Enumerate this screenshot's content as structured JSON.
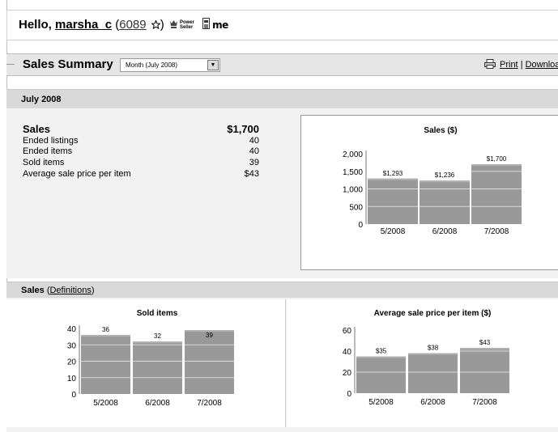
{
  "greeting": {
    "hello": "Hello,",
    "username": "marsha_c",
    "score_open": "(",
    "score": "6089",
    "score_close": ")",
    "power_seller_line1": "Power",
    "power_seller_line2": "Seller",
    "me_badge": "me",
    "star_icon": "star-icon",
    "power_seller_icon": "power-seller-icon",
    "store_icon": "store-icon"
  },
  "summary": {
    "title": "Sales Summary",
    "period_selected": "Month (July 2008)",
    "print_label": "Print",
    "separator": "|",
    "download_label": "Download"
  },
  "month": {
    "title": "July 2008",
    "sales_label": "Sales",
    "sales_value": "$1,700",
    "rows": [
      {
        "label": "Ended listings",
        "value": "40"
      },
      {
        "label": "Ended items",
        "value": "40"
      },
      {
        "label": "Sold items",
        "value": "39"
      },
      {
        "label": "Average sale price per item",
        "value": "$43"
      }
    ]
  },
  "sales_section": {
    "title": "Sales",
    "definitions_label": "Definitions",
    "open": "(",
    "close": ")"
  },
  "colors": {
    "bar": "#999999",
    "bar_line": "#d8d8d8",
    "bar_top": "#b0b0b0"
  },
  "chart_data": [
    {
      "id": "sales-chart",
      "type": "bar",
      "title": "Sales ($)",
      "categories": [
        "5/2008",
        "6/2008",
        "7/2008"
      ],
      "values": [
        1293,
        1236,
        1700
      ],
      "data_labels": [
        "$1,293",
        "$1,236",
        "$1,700"
      ],
      "y_ticks": [
        0,
        500,
        1000,
        1500,
        2000
      ],
      "y_tick_labels": [
        "0",
        "500",
        "1,000",
        "1,500",
        "2,000"
      ],
      "ylim": [
        0,
        2000
      ]
    },
    {
      "id": "sold-chart",
      "type": "bar",
      "title": "Sold items",
      "categories": [
        "5/2008",
        "6/2008",
        "7/2008"
      ],
      "values": [
        36,
        32,
        39
      ],
      "data_labels": [
        "36",
        "32",
        "39"
      ],
      "y_ticks": [
        0,
        10,
        20,
        30,
        40
      ],
      "y_tick_labels": [
        "0",
        "10",
        "20",
        "30",
        "40"
      ],
      "ylim": [
        0,
        40
      ]
    },
    {
      "id": "avg-chart",
      "type": "bar",
      "title": "Average sale price per item ($)",
      "categories": [
        "5/2008",
        "6/2008",
        "7/2008"
      ],
      "values": [
        35,
        38,
        43
      ],
      "data_labels": [
        "$35",
        "$38",
        "$43"
      ],
      "y_ticks": [
        0,
        20,
        40,
        60
      ],
      "y_tick_labels": [
        "0",
        "20",
        "40",
        "60"
      ],
      "ylim": [
        0,
        60
      ]
    }
  ]
}
